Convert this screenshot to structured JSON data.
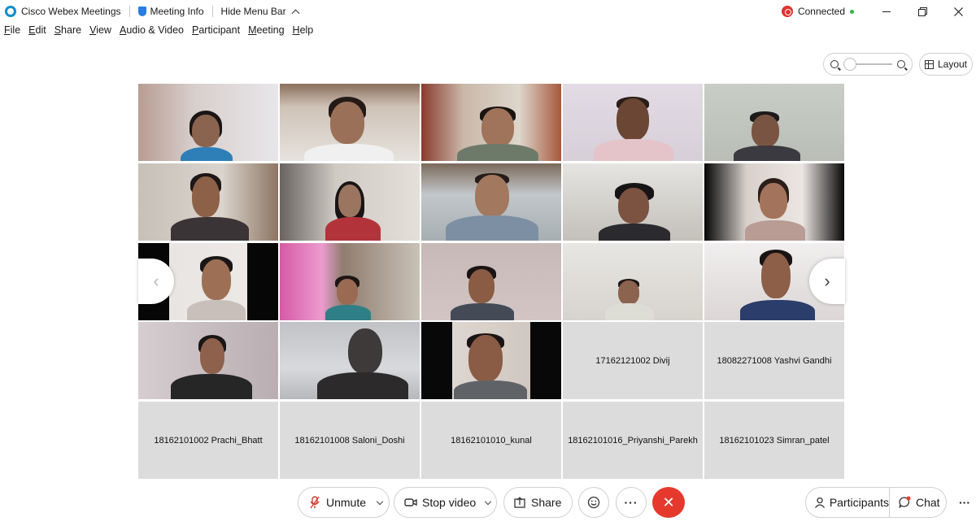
{
  "titlebar": {
    "app_name": "Cisco Webex Meetings",
    "meeting_info": "Meeting Info",
    "hide_menu": "Hide Menu Bar",
    "status": "Connected"
  },
  "menu": [
    "File",
    "Edit",
    "Share",
    "View",
    "Audio & Video",
    "Participant",
    "Meeting",
    "Help"
  ],
  "layout_label": "Layout",
  "name_tiles": [
    "17162121002 Divij",
    "18082271008 Yashvi Gandhi",
    "18162101002 Prachi_Bhatt",
    "18162101008 Saloni_Doshi",
    "18162101010_kunal",
    "18162101016_Priyanshi_Parekh",
    "18162101023 Simran_patel"
  ],
  "controls": {
    "unmute": "Unmute",
    "stop_video": "Stop video",
    "share": "Share",
    "participants": "Participants",
    "chat": "Chat"
  },
  "colors": {
    "end_call": "#e5392d",
    "webex_blue": "#0c8ec9",
    "connected_dot": "#2fb344"
  }
}
